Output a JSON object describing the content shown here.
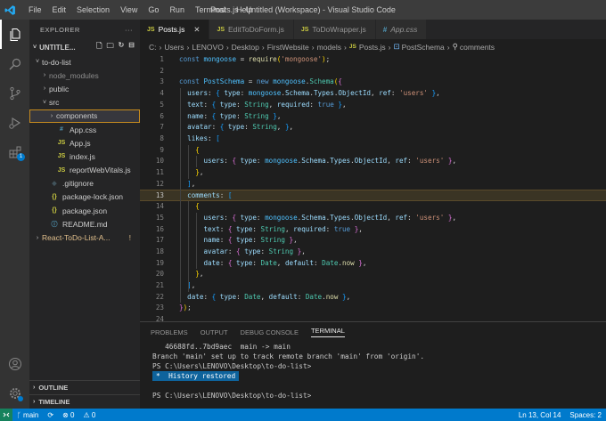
{
  "window": {
    "title": "Posts.js - Untitled (Workspace) - Visual Studio Code",
    "menu": [
      "File",
      "Edit",
      "Selection",
      "View",
      "Go",
      "Run",
      "Terminal",
      "Help"
    ]
  },
  "activity_bar": {
    "items": [
      "files-icon",
      "search-icon",
      "source-control-icon",
      "run-debug-icon",
      "extensions-icon"
    ],
    "extensions_badge": "1",
    "bottom": [
      "account-icon",
      "manage-gear-icon"
    ]
  },
  "explorer": {
    "header": "EXPLORER",
    "more": "···",
    "workspace": "UNTITLE...",
    "tree": [
      {
        "label": "to-do-list",
        "indent": 0,
        "chev": "˅",
        "icon": "",
        "color": "#cccccc"
      },
      {
        "label": "node_modules",
        "indent": 1,
        "chev": "›",
        "icon": "",
        "color": "#8c8c8c"
      },
      {
        "label": "public",
        "indent": 1,
        "chev": "›",
        "icon": "",
        "color": "#cccccc"
      },
      {
        "label": "src",
        "indent": 1,
        "chev": "˅",
        "icon": "",
        "color": "#cccccc"
      },
      {
        "label": "components",
        "indent": 2,
        "chev": "›",
        "icon": "",
        "color": "#cccccc",
        "selected": true
      },
      {
        "label": "App.css",
        "indent": 2,
        "chev": "",
        "icon": "#",
        "icon_color": "#519aba",
        "color": "#cccccc"
      },
      {
        "label": "App.js",
        "indent": 2,
        "chev": "",
        "icon": "JS",
        "icon_color": "#cbcb41",
        "color": "#cccccc"
      },
      {
        "label": "index.js",
        "indent": 2,
        "chev": "",
        "icon": "JS",
        "icon_color": "#cbcb41",
        "color": "#cccccc"
      },
      {
        "label": "reportWebVitals.js",
        "indent": 2,
        "chev": "",
        "icon": "JS",
        "icon_color": "#cbcb41",
        "color": "#cccccc"
      },
      {
        "label": ".gitignore",
        "indent": 1,
        "chev": "",
        "icon": "◆",
        "icon_color": "#41535b",
        "color": "#cccccc"
      },
      {
        "label": "package-lock.json",
        "indent": 1,
        "chev": "",
        "icon": "{}",
        "icon_color": "#cbcb41",
        "color": "#cccccc"
      },
      {
        "label": "package.json",
        "indent": 1,
        "chev": "",
        "icon": "{}",
        "icon_color": "#cbcb41",
        "color": "#cccccc"
      },
      {
        "label": "README.md",
        "indent": 1,
        "chev": "",
        "icon": "ⓘ",
        "icon_color": "#519aba",
        "color": "#cccccc"
      },
      {
        "label": "React-ToDo-List-A...",
        "indent": 0,
        "chev": "›",
        "icon": "",
        "color": "#e2c08d",
        "modified": "!"
      }
    ],
    "outline": "OUTLINE",
    "timeline": "TIMELINE"
  },
  "tabs": [
    {
      "label": "Posts.js",
      "type": "JS",
      "active": true,
      "close": "✕"
    },
    {
      "label": "EditToDoForm.js",
      "type": "JS",
      "active": false
    },
    {
      "label": "ToDoWrapper.js",
      "type": "JS",
      "active": false
    },
    {
      "label": "App.css",
      "type": "#",
      "active": false
    }
  ],
  "breadcrumb": [
    "C:",
    "Users",
    "LENOVO",
    "Desktop",
    "FirstWebsite",
    "models",
    "Posts.js",
    "PostSchema",
    "comments"
  ],
  "code": {
    "current_line": 13,
    "lines": [
      {
        "n": "1",
        "html": "<span class='k'>const</span> <span class='v'>mongoose</span> = <span class='f'>require</span><span class='b1'>(</span><span class='s'>'mongoose'</span><span class='b1'>)</span>;"
      },
      {
        "n": "2",
        "html": ""
      },
      {
        "n": "3",
        "html": "<span class='k'>const</span> <span class='v'>PostSchema</span> = <span class='k'>new</span> <span class='v'>mongoose</span>.<span class='t'>Schema</span><span class='b1'>(</span><span class='b2'>{</span>"
      },
      {
        "n": "4",
        "html": "  <span class='p'>users</span>: <span class='b3'>{</span> <span class='p'>type</span>: <span class='v'>mongoose</span>.<span class='p'>Schema</span>.<span class='p'>Types</span>.<span class='p'>ObjectId</span>, <span class='p'>ref</span>: <span class='s'>'users'</span> <span class='b3'>}</span>,"
      },
      {
        "n": "5",
        "html": "  <span class='p'>text</span>: <span class='b3'>{</span> <span class='p'>type</span>: <span class='t'>String</span>, <span class='p'>required</span>: <span class='k'>true</span> <span class='b3'>}</span>,"
      },
      {
        "n": "6",
        "html": "  <span class='p'>name</span>: <span class='b3'>{</span> <span class='p'>type</span>: <span class='t'>String</span> <span class='b3'>}</span>,"
      },
      {
        "n": "7",
        "html": "  <span class='p'>avatar</span>: <span class='b3'>{</span> <span class='p'>type</span>: <span class='t'>String</span>, <span class='b3'>}</span>,"
      },
      {
        "n": "8",
        "html": "  <span class='p'>likes</span>: <span class='b3'>[</span>"
      },
      {
        "n": "9",
        "html": "    <span class='b1'>{</span>"
      },
      {
        "n": "10",
        "html": "      <span class='p'>users</span>: <span class='b2'>{</span> <span class='p'>type</span>: <span class='v'>mongoose</span>.<span class='p'>Schema</span>.<span class='p'>Types</span>.<span class='p'>ObjectId</span>, <span class='p'>ref</span>: <span class='s'>'users'</span> <span class='b2'>}</span>,"
      },
      {
        "n": "11",
        "html": "    <span class='b1'>}</span>,"
      },
      {
        "n": "12",
        "html": "  <span class='b3'>]</span>,"
      },
      {
        "n": "13",
        "html": "  <span class='p'>comments</span>: <span class='b3'>[</span>"
      },
      {
        "n": "14",
        "html": "    <span class='b1'>{</span>"
      },
      {
        "n": "15",
        "html": "      <span class='p'>users</span>: <span class='b2'>{</span> <span class='p'>type</span>: <span class='v'>mongoose</span>.<span class='p'>Schema</span>.<span class='p'>Types</span>.<span class='p'>ObjectId</span>, <span class='p'>ref</span>: <span class='s'>'users'</span> <span class='b2'>}</span>,"
      },
      {
        "n": "16",
        "html": "      <span class='p'>text</span>: <span class='b2'>{</span> <span class='p'>type</span>: <span class='t'>String</span>, <span class='p'>required</span>: <span class='k'>true</span> <span class='b2'>}</span>,"
      },
      {
        "n": "17",
        "html": "      <span class='p'>name</span>: <span class='b2'>{</span> <span class='p'>type</span>: <span class='t'>String</span> <span class='b2'>}</span>,"
      },
      {
        "n": "18",
        "html": "      <span class='p'>avatar</span>: <span class='b2'>{</span> <span class='p'>type</span>: <span class='t'>String</span> <span class='b2'>}</span>,"
      },
      {
        "n": "19",
        "html": "      <span class='p'>date</span>: <span class='b2'>{</span> <span class='p'>type</span>: <span class='t'>Date</span>, <span class='p'>default</span>: <span class='t'>Date</span>.<span class='f'>now</span> <span class='b2'>}</span>,"
      },
      {
        "n": "20",
        "html": "    <span class='b1'>}</span>,"
      },
      {
        "n": "21",
        "html": "  <span class='b3'>]</span>,"
      },
      {
        "n": "22",
        "html": "  <span class='p'>date</span>: <span class='b3'>{</span> <span class='p'>type</span>: <span class='t'>Date</span>, <span class='p'>default</span>: <span class='t'>Date</span>.<span class='f'>now</span> <span class='b3'>}</span>,"
      },
      {
        "n": "23",
        "html": "<span class='b2'>}</span><span class='b1'>)</span>;"
      },
      {
        "n": "24",
        "html": ""
      },
      {
        "n": "25",
        "html": "<span class='v'>module</span>.<span class='v'>exports</span> = <span class='v'>Posts</span> = <span class='v'>mongoose</span>.<span class='f'>model</span><span class='b1'>(</span><span class='s'>'posts'</span>, <span class='v'>PostSchema</span><span class='b1'>)</span>;"
      }
    ]
  },
  "panel": {
    "tabs": [
      "PROBLEMS",
      "OUTPUT",
      "DEBUG CONSOLE",
      "TERMINAL"
    ],
    "active_tab": "TERMINAL",
    "terminal": [
      "   46688fd..7bd9aec  main -> main",
      "Branch 'main' set up to track remote branch 'main' from 'origin'.",
      "PS C:\\Users\\LENOVO\\Desktop\\to-do-list>",
      "",
      "",
      "PS C:\\Users\\LENOVO\\Desktop\\to-do-list>"
    ],
    "history": "*  History restored"
  },
  "status": {
    "branch": "main",
    "sync": "⟳",
    "errors": "⊗ 0",
    "warnings": "⚠ 0",
    "position": "Ln 13, Col 14",
    "spaces": "Spaces: 2"
  },
  "colors": {
    "accent": "#007acc",
    "selection_outline": "#c68b1f",
    "titlebar": "#3c3c3c",
    "sidebar": "#252526",
    "editor": "#1e1e1e"
  }
}
